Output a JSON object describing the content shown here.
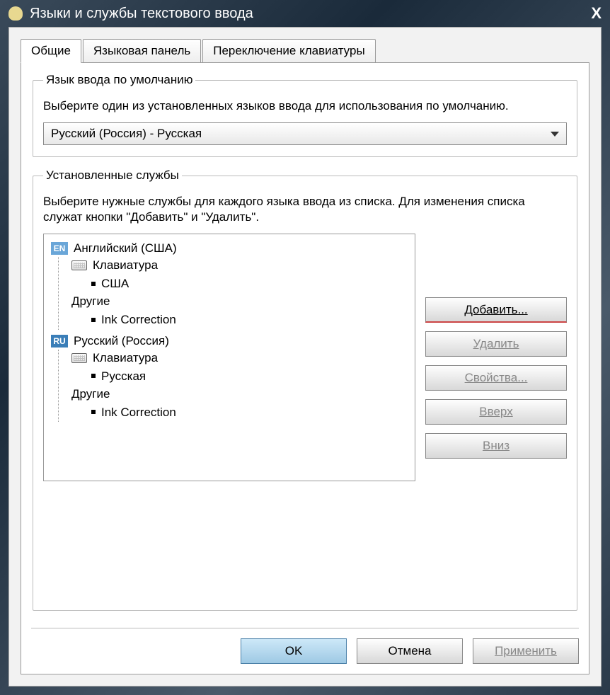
{
  "window": {
    "title": "Языки и службы текстового ввода"
  },
  "tabs": [
    {
      "label": "Общие",
      "active": true
    },
    {
      "label": "Языковая панель",
      "active": false
    },
    {
      "label": "Переключение клавиатуры",
      "active": false
    }
  ],
  "default_lang": {
    "legend": "Язык ввода по умолчанию",
    "help": "Выберите один из установленных языков ввода для использования по умолчанию.",
    "selected": "Русский (Россия) - Русская"
  },
  "services": {
    "legend": "Установленные службы",
    "help": "Выберите нужные службы для каждого языка ввода из списка. Для изменения списка служат кнопки \"Добавить\" и \"Удалить\".",
    "langs": [
      {
        "code": "EN",
        "name": "Английский (США)",
        "groups": [
          {
            "title": "Клавиатура",
            "items": [
              "США"
            ]
          },
          {
            "title": "Другие",
            "items": [
              "Ink Correction"
            ]
          }
        ]
      },
      {
        "code": "RU",
        "name": "Русский (Россия)",
        "groups": [
          {
            "title": "Клавиатура",
            "items": [
              "Русская"
            ]
          },
          {
            "title": "Другие",
            "items": [
              "Ink Correction"
            ]
          }
        ]
      }
    ],
    "buttons": {
      "add": "Добавить...",
      "remove": "Удалить",
      "properties": "Свойства...",
      "up": "Вверх",
      "down": "Вниз"
    }
  },
  "bottom": {
    "ok": "OK",
    "cancel": "Отмена",
    "apply": "Применить"
  }
}
